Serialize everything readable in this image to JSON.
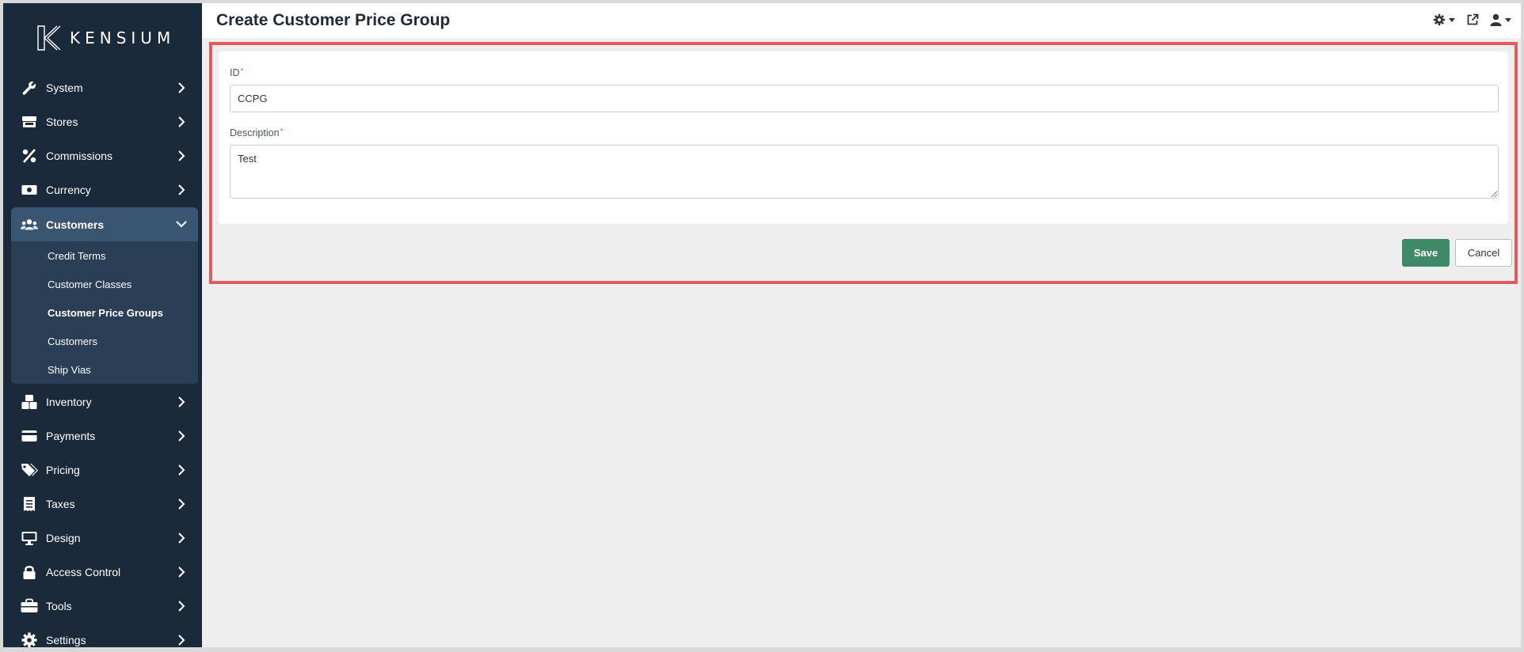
{
  "brand": {
    "name": "KENSIUM"
  },
  "sidebar": {
    "items": [
      {
        "label": "System",
        "icon": "wrench-icon"
      },
      {
        "label": "Stores",
        "icon": "store-icon"
      },
      {
        "label": "Commissions",
        "icon": "percent-icon"
      },
      {
        "label": "Currency",
        "icon": "money-bill-icon"
      },
      {
        "label": "Customers",
        "icon": "users-icon",
        "expanded": true
      },
      {
        "label": "Inventory",
        "icon": "boxes-icon"
      },
      {
        "label": "Payments",
        "icon": "credit-card-icon"
      },
      {
        "label": "Pricing",
        "icon": "tags-icon"
      },
      {
        "label": "Taxes",
        "icon": "receipt-icon"
      },
      {
        "label": "Design",
        "icon": "desktop-icon"
      },
      {
        "label": "Access Control",
        "icon": "lock-icon"
      },
      {
        "label": "Tools",
        "icon": "toolbox-icon"
      },
      {
        "label": "Settings",
        "icon": "gear-icon"
      }
    ],
    "customers_submenu": [
      {
        "label": "Credit Terms"
      },
      {
        "label": "Customer Classes"
      },
      {
        "label": "Customer Price Groups",
        "current": true
      },
      {
        "label": "Customers"
      },
      {
        "label": "Ship Vias"
      }
    ]
  },
  "header": {
    "title": "Create Customer Price Group",
    "tools": [
      "settings-dropdown-icon",
      "external-link-icon",
      "user-dropdown-icon"
    ]
  },
  "form": {
    "id_label": "ID",
    "id_value": "CCPG",
    "description_label": "Description",
    "description_value": "Test",
    "required_marker": "*"
  },
  "actions": {
    "save_label": "Save",
    "cancel_label": "Cancel"
  },
  "colors": {
    "sidebar_bg": "#1b2a3a",
    "active_item_bg": "#395572",
    "submenu_bg": "#2a3f55",
    "save_button": "#3f8868",
    "highlight_border": "#e05a5e"
  }
}
